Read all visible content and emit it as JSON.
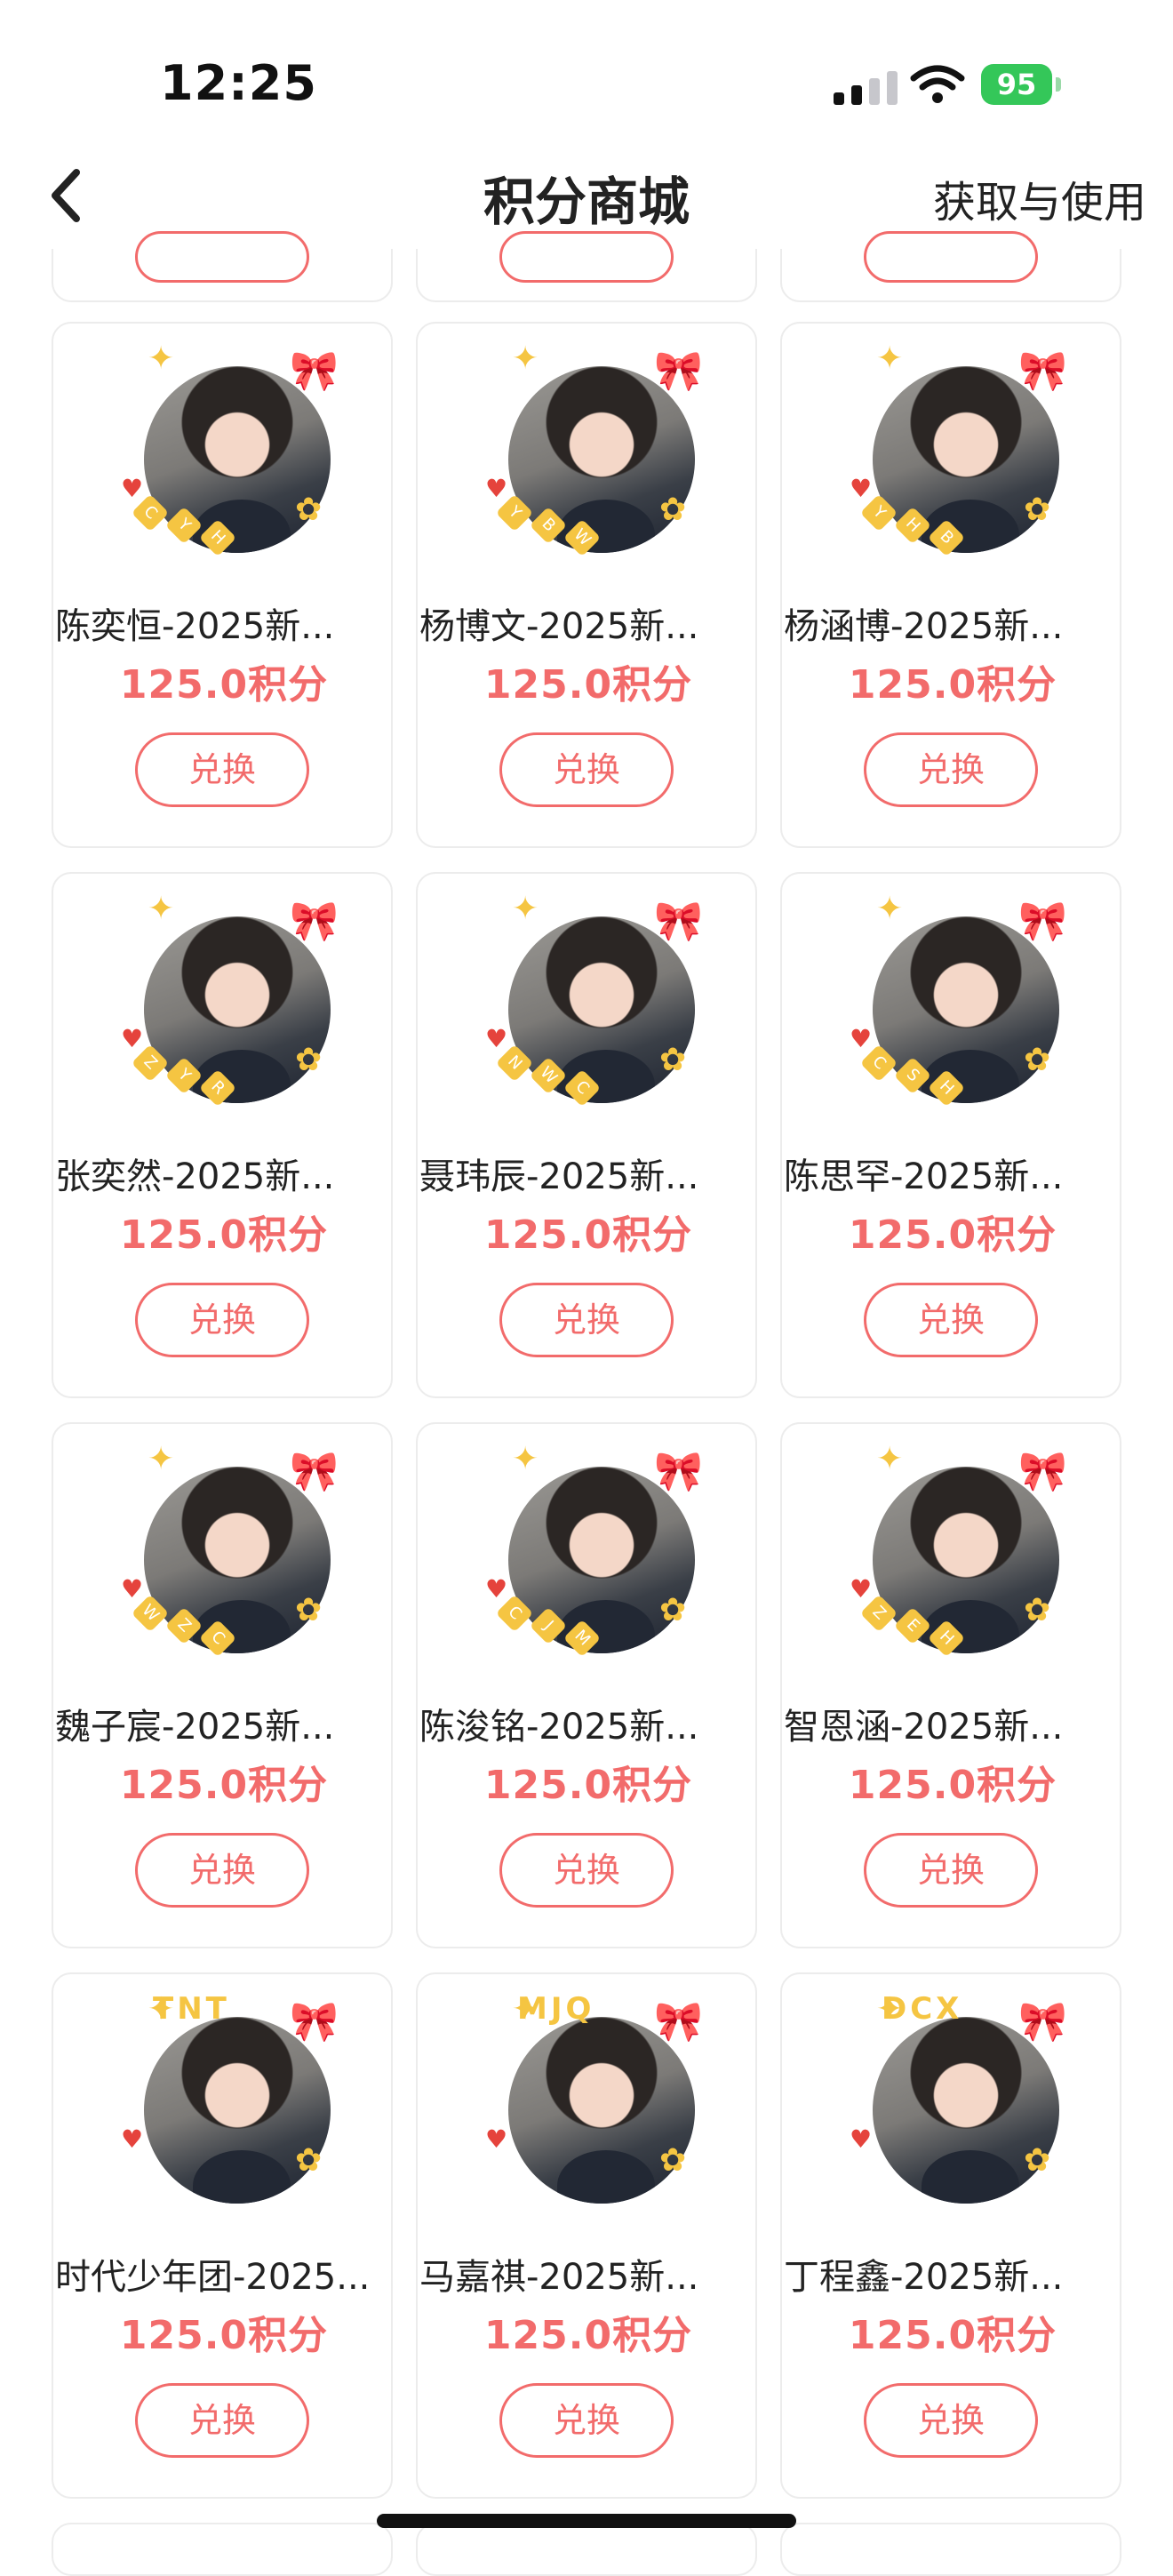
{
  "status": {
    "time": "12:25",
    "battery": "95"
  },
  "nav": {
    "title": "积分商城",
    "action": "获取与使用"
  },
  "products": [
    {
      "name": "陈奕恒-2025新...",
      "price": "125.0积分",
      "button": "兑换",
      "letters": [
        "C",
        "Y",
        "H"
      ]
    },
    {
      "name": "杨博文-2025新...",
      "price": "125.0积分",
      "button": "兑换",
      "letters": [
        "Y",
        "B",
        "W"
      ]
    },
    {
      "name": "杨涵博-2025新...",
      "price": "125.0积分",
      "button": "兑换",
      "letters": [
        "Y",
        "H",
        "B"
      ]
    },
    {
      "name": "张奕然-2025新...",
      "price": "125.0积分",
      "button": "兑换",
      "letters": [
        "Z",
        "Y",
        "R"
      ]
    },
    {
      "name": "聂玮辰-2025新...",
      "price": "125.0积分",
      "button": "兑换",
      "letters": [
        "N",
        "W",
        "C"
      ]
    },
    {
      "name": "陈思罕-2025新...",
      "price": "125.0积分",
      "button": "兑换",
      "letters": [
        "C",
        "S",
        "H"
      ]
    },
    {
      "name": "魏子宸-2025新...",
      "price": "125.0积分",
      "button": "兑换",
      "letters": [
        "W",
        "Z",
        "C"
      ]
    },
    {
      "name": "陈浚铭-2025新...",
      "price": "125.0积分",
      "button": "兑换",
      "letters": [
        "C",
        "J",
        "M"
      ]
    },
    {
      "name": "智恩涵-2025新...",
      "price": "125.0积分",
      "button": "兑换",
      "letters": [
        "Z",
        "E",
        "H"
      ]
    },
    {
      "name": "时代少年团-2025...",
      "price": "125.0积分",
      "button": "兑换",
      "letters": [
        "TNT"
      ]
    },
    {
      "name": "马嘉祺-2025新...",
      "price": "125.0积分",
      "button": "兑换",
      "letters": [
        "MJQ"
      ]
    },
    {
      "name": "丁程鑫-2025新...",
      "price": "125.0积分",
      "button": "兑换",
      "letters": [
        "DCX"
      ]
    }
  ],
  "colors": {
    "accent": "#f26b6b",
    "battery": "#34c759"
  }
}
